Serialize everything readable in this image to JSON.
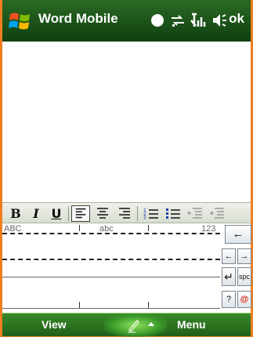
{
  "title_bar": {
    "app_title": "Word Mobile",
    "ok_label": "ok",
    "icons": [
      "windows-start-icon",
      "notification-icon",
      "connectivity-icon",
      "signal-icon",
      "volume-icon"
    ]
  },
  "format_toolbar": {
    "bold": "B",
    "italic": "I",
    "underline": "U",
    "buttons": [
      "bold",
      "italic",
      "underline",
      "align-left",
      "align-center",
      "align-right",
      "numbered-list",
      "bulleted-list",
      "decrease-indent",
      "increase-indent"
    ]
  },
  "input_panel": {
    "zones": [
      "ABC",
      "abc",
      "123"
    ],
    "keys": {
      "backspace": "←",
      "left": "←",
      "right": "→",
      "enter": "↵",
      "space": "spc",
      "help": "?",
      "symbols": "@"
    }
  },
  "bottom_bar": {
    "left_softkey": "View",
    "right_softkey": "Menu",
    "input_icon": "pen-icon"
  },
  "colors": {
    "frame": "#f07e1e",
    "title_bar": "#1f5a1a",
    "bottom_bar": "#2c7a20"
  }
}
